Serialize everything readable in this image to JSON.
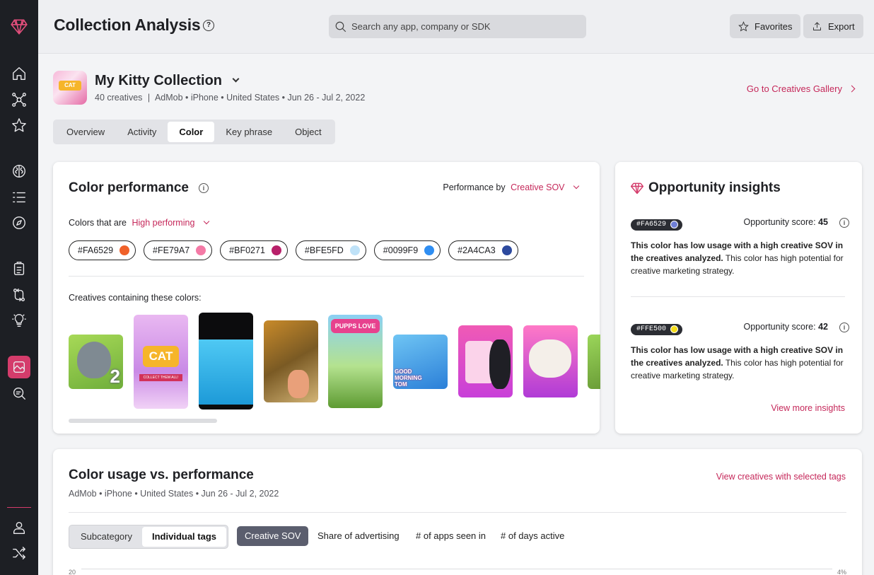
{
  "sidebar": {
    "icons": [
      "logo-gem-icon",
      "home-icon",
      "network-icon",
      "star-icon",
      "brain-icon",
      "list-icon",
      "compass-icon",
      "clipboard-icon",
      "compare-icon",
      "bulb-icon",
      "gallery-icon",
      "search-list-icon",
      "user-icon",
      "shuffle-icon"
    ]
  },
  "header": {
    "title": "Collection Analysis",
    "search_placeholder": "Search any app, company or SDK",
    "favorites": "Favorites",
    "export": "Export"
  },
  "collection": {
    "name": "My Kitty Collection",
    "creatives": "40 creatives",
    "meta": "AdMob • iPhone • United States • Jun 26 - Jul 2, 2022",
    "gallery_link": "Go to Creatives Gallery",
    "icon_text": "CAT"
  },
  "tabs": [
    "Overview",
    "Activity",
    "Color",
    "Key phrase",
    "Object"
  ],
  "active_tab": "Color",
  "color_performance": {
    "title": "Color performance",
    "performance_by_label": "Performance by",
    "performance_by_value": "Creative SOV",
    "filter_label": "Colors that are",
    "filter_value": "High performing",
    "colors": [
      {
        "hex": "#FA6529",
        "swatch": "#f0612a"
      },
      {
        "hex": "#FE79A7",
        "swatch": "#f47aa6"
      },
      {
        "hex": "#BF0271",
        "swatch": "#b8206a"
      },
      {
        "hex": "#BFE5FD",
        "swatch": "#bfe2f8"
      },
      {
        "hex": "#0099F9",
        "swatch": "#2f8ef2"
      },
      {
        "hex": "#2A4CA3",
        "swatch": "#2d4a9e"
      }
    ],
    "creatives_label": "Creatives containing these colors:"
  },
  "insights": {
    "title": "Opportunity insights",
    "items": [
      {
        "hex": "#FA6529",
        "swatch": "#6f7fd6",
        "score_label": "Opportunity score:",
        "score": "45",
        "bold": "This color has low usage with a high creative SOV in the creatives analyzed.",
        "text": " This color has high potential for creative marketing strategy."
      },
      {
        "hex": "#FFE500",
        "swatch": "#f4dc1a",
        "score_label": "Opportunity score:",
        "score": "42",
        "bold": "This color has low usage with a high creative SOV in the creatives analyzed.",
        "text": " This color has high potential for creative marketing strategy."
      }
    ],
    "more_link": "View more insights"
  },
  "usage": {
    "title": "Color usage vs. performance",
    "meta": "AdMob • iPhone • United States • Jun 26 - Jul 2, 2022",
    "link": "View creatives with selected tags",
    "segments": [
      "Subcategory",
      "Individual tags"
    ],
    "active_segment": "Individual tags",
    "metrics": [
      "Creative SOV",
      "Share of advertising",
      "# of apps seen in",
      "# of days active"
    ],
    "active_metric": "Creative SOV",
    "y_left_top": "20",
    "y_right_top": "4%"
  },
  "thumb_labels": {
    "cat": "CAT",
    "collect": "COLLECT THEM ALL!",
    "pups": "PUPPS LOVE",
    "morning": "GOOD MORNING TOM",
    "tom2": "2"
  }
}
